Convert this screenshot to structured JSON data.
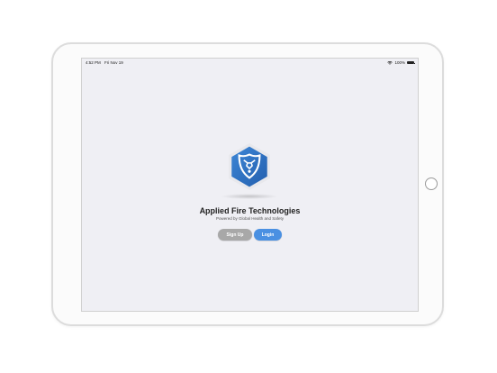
{
  "status_bar": {
    "time": "4:52 PM",
    "date": "Fri Nov 19",
    "battery": "100%"
  },
  "app": {
    "title": "Applied Fire Technologies",
    "subtitle": "Powered by Global Health and Safety",
    "logo_icon": "shield-hexagon-icon"
  },
  "buttons": {
    "signup_label": "Sign Up",
    "login_label": "Login"
  },
  "colors": {
    "primary": "#4a90e2",
    "secondary": "#a8a8a8",
    "logo_blue": "#2f72c4"
  }
}
